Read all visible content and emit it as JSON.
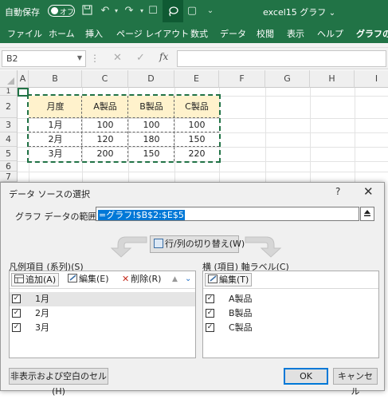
{
  "titlebar": {
    "autosave_label": "自動保存",
    "autosave_state": "オフ",
    "document_title": "excel15 グラフ",
    "title_caret": "⌄"
  },
  "ribbon": {
    "tabs": [
      "ファイル",
      "ホーム",
      "挿入",
      "ページ レイアウト",
      "数式",
      "データ",
      "校閲",
      "表示",
      "ヘルプ",
      "グラフのデ"
    ]
  },
  "formula_bar": {
    "name_box": "B2",
    "fx_label": "fx"
  },
  "sheet": {
    "columns": [
      "A",
      "B",
      "C",
      "D",
      "E",
      "F",
      "G",
      "H",
      "I"
    ],
    "rows": [
      "1",
      "2",
      "3",
      "4",
      "5",
      "6",
      "7"
    ],
    "header": [
      "月度",
      "A製品",
      "B製品",
      "C製品"
    ],
    "data": [
      [
        "1月",
        "100",
        "100",
        "100"
      ],
      [
        "2月",
        "120",
        "180",
        "150"
      ],
      [
        "3月",
        "200",
        "150",
        "220"
      ]
    ],
    "header_fill": "#fff2cc",
    "accent": "#217346"
  },
  "dialog": {
    "title": "データ ソースの選択",
    "help": "?",
    "close": "✕",
    "range_label": "グラフ データの範囲(D):",
    "range_value": "=グラフ!$B$2:$E$5",
    "switch_label": "行/列の切り替え(W)",
    "series_panel": {
      "label": "凡例項目 (系列)(S)",
      "add": "追加(A)",
      "edit": "編集(E)",
      "delete": "削除(R)",
      "items": [
        "1月",
        "2月",
        "3月"
      ],
      "checked": [
        true,
        true,
        true
      ]
    },
    "axis_panel": {
      "label": "横 (項目) 軸ラベル(C)",
      "edit": "編集(T)",
      "items": [
        "A製品",
        "B製品",
        "C製品"
      ],
      "checked": [
        true,
        true,
        true
      ]
    },
    "hidden_cells_button": "非表示および空白のセル(H)",
    "ok": "OK",
    "cancel": "キャンセル"
  }
}
